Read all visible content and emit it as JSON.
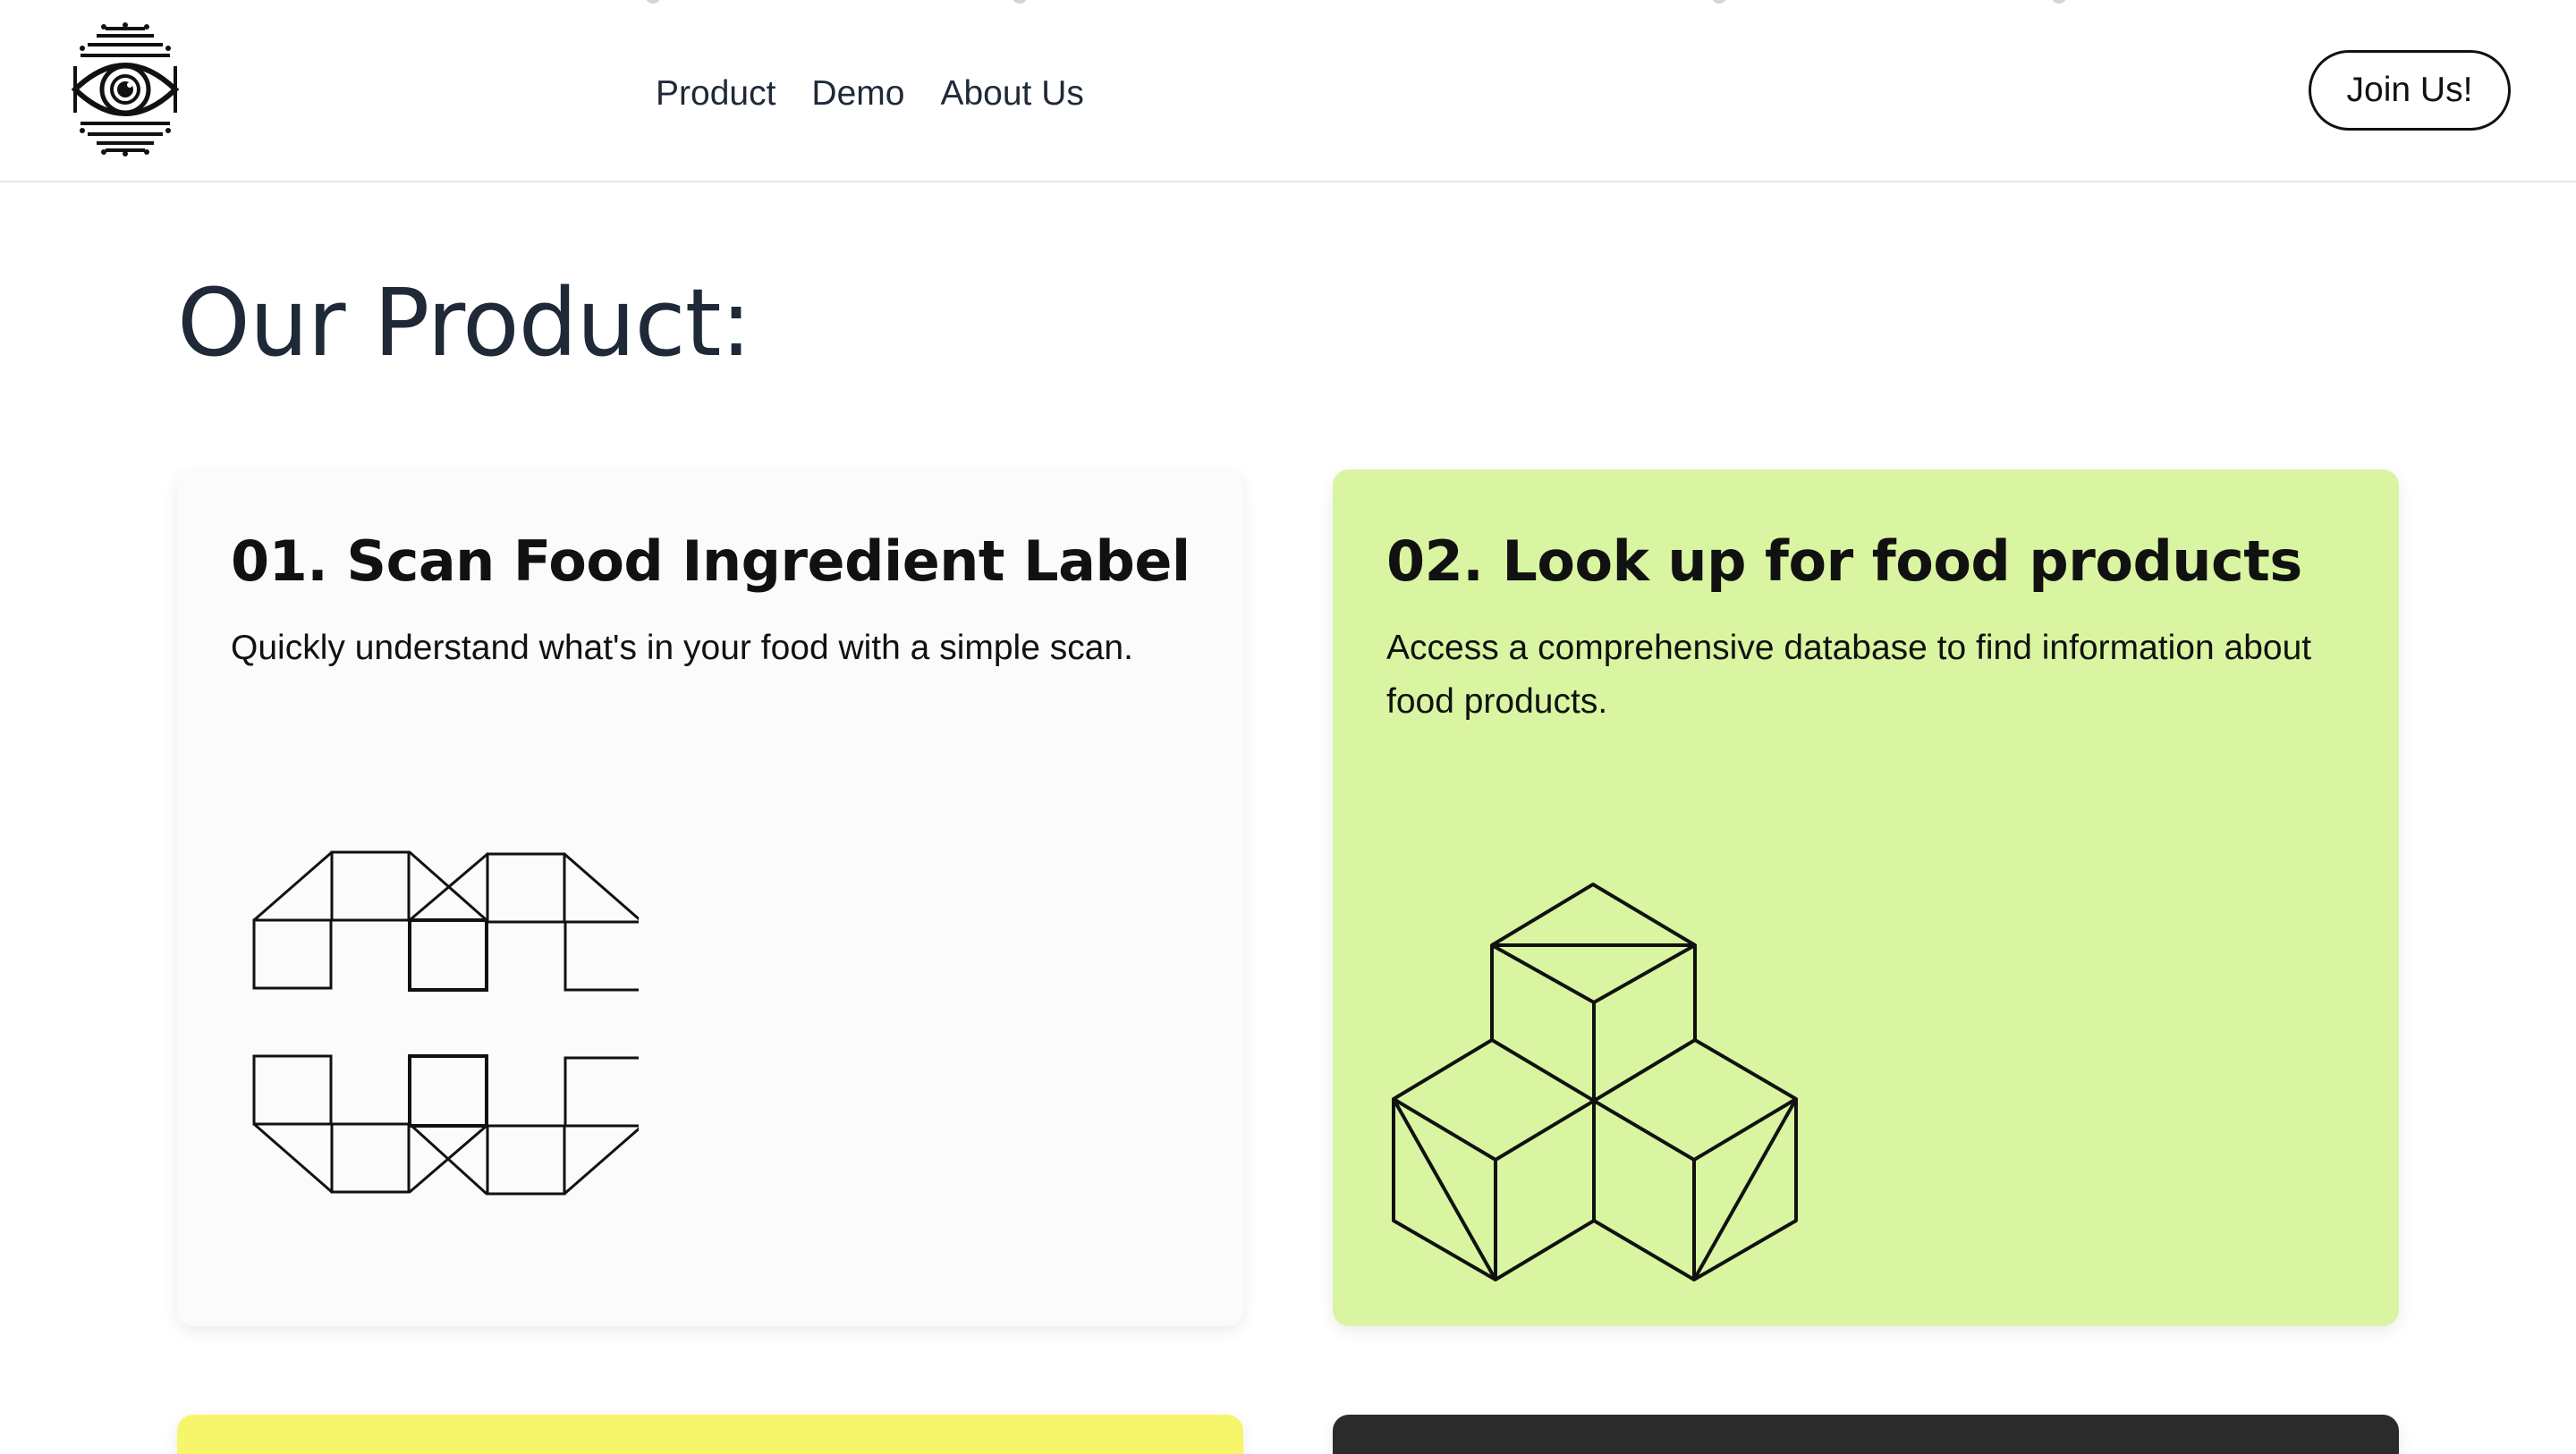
{
  "header": {
    "logo_icon": "eye-circuit-logo-icon",
    "nav": [
      {
        "label": "Product"
      },
      {
        "label": "Demo"
      },
      {
        "label": "About Us"
      }
    ],
    "join_label": "Join Us!"
  },
  "main": {
    "title": "Our Product:",
    "cards": [
      {
        "title": "01. Scan Food Ingredient Label",
        "description": "Quickly understand what's in your food with a simple scan.",
        "background": "#fbfbfb",
        "icon": "scan-frame-icon"
      },
      {
        "title": "02. Look up for food products",
        "description": "Access a comprehensive database to find information about food products.",
        "background": "#d9f5a1",
        "icon": "stacked-cubes-icon"
      },
      {
        "background": "#f7f56b"
      },
      {
        "background": "#2b2b2b"
      }
    ]
  }
}
